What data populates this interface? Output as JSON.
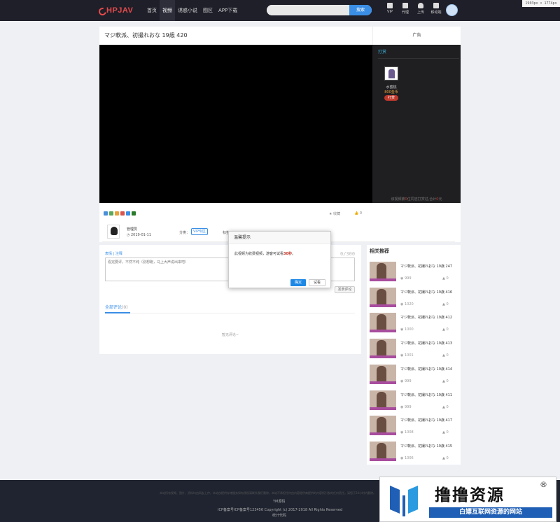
{
  "topbar": {
    "logo_text": "HPJAV",
    "nav": [
      "首页",
      "视频",
      "诱惑小说",
      "图区",
      "APP下载"
    ],
    "search_button": "搜索",
    "tools": [
      "VIP",
      "代理",
      "上传",
      "移动端"
    ],
    "size_badge": "1903px × 1774px"
  },
  "video": {
    "title": "マジ軟派、初撮れおな 19歳 420",
    "ad_label": "广告",
    "side_tab": "打赏",
    "donor_name": "水蜜桃",
    "donor_coins": "800金币",
    "donor_button": "打赏",
    "side_footer_a": "该视频被",
    "side_footer_n1": "0",
    "side_footer_b": "位同志打赏过,合计",
    "side_footer_n2": "0",
    "side_footer_c": "元"
  },
  "actions": {
    "collect": "收藏",
    "like": "0"
  },
  "author": {
    "name": "管理员",
    "date": "2019-01-11",
    "category_label": "分类：",
    "category_tag": "VIP专区",
    "tag_label": "标签："
  },
  "comment": {
    "links": "表情 | 注释",
    "count": "0/300",
    "placeholder": "看完要评，不然不纯（别想跑，马上大声说出来吧）",
    "submit": "发表评论",
    "all_title": "全部评论",
    "all_count": "(0)",
    "empty": "暂无评论~"
  },
  "related": {
    "title": "相关推荐",
    "items": [
      {
        "name": "マジ軟派、初撮れおな 19歳 247",
        "views": "999",
        "likes": "0"
      },
      {
        "name": "マジ軟派、初撮れおな 19歳 416",
        "views": "1020",
        "likes": "0"
      },
      {
        "name": "マジ軟派、初撮れおな 19歳 412",
        "views": "1000",
        "likes": "0"
      },
      {
        "name": "マジ軟派、初撮れおな 19歳 413",
        "views": "1001",
        "likes": "0"
      },
      {
        "name": "マジ軟派、初撮れおな 19歳 414",
        "views": "999",
        "likes": "0"
      },
      {
        "name": "マジ軟派、初撮れおな 19歳 411",
        "views": "999",
        "likes": "0"
      },
      {
        "name": "マジ軟派、初撮れおな 19歳 417",
        "views": "1008",
        "likes": "0"
      },
      {
        "name": "マジ軟派、初撮れおな 19歳 415",
        "views": "1006",
        "likes": "0"
      }
    ]
  },
  "modal": {
    "title": "温馨提示",
    "text_a": "此视频为收费视频，游客可试看",
    "text_b": "30秒",
    "text_c": "。",
    "ok": "确定",
    "try": "试看"
  },
  "footer": {
    "disclaimer": "本站所有视频、图片、资料均由网友上传，本站仅提供存储服务如有侵权请联系我们删除，本站不承担任何由内容提供商提供的内容所引发的任何责任。请您于24小时内删除。",
    "source": "YM源码",
    "copyright": "ICP备案号ICP备案号123456   Copyright (c) 2017-2018 All Rights Reserved",
    "stats": "统计代码"
  },
  "watermark": {
    "main": "撸撸资源",
    "reg": "®",
    "sub": "白嫖互联网资源的网站"
  }
}
